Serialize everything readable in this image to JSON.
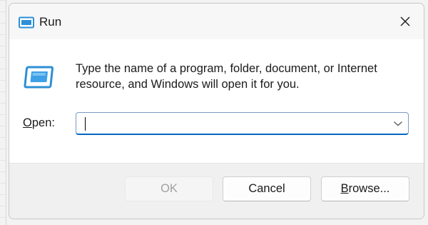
{
  "window": {
    "title": "Run",
    "close_glyph": "✕",
    "icons": {
      "title": "run-icon",
      "large": "run-icon",
      "close": "close-icon",
      "dropdown": "chevron-down-icon"
    }
  },
  "content": {
    "instructions": "Type the name of a program, folder, document, or Internet resource, and Windows will open it for you.",
    "open_label_mnemonic": "O",
    "open_label_rest": "pen:",
    "open_value": "",
    "open_placeholder": ""
  },
  "buttons": {
    "ok_label": "OK",
    "cancel_label": "Cancel",
    "browse_mnemonic": "B",
    "browse_rest": "rowse..."
  },
  "colors": {
    "accent": "#0067c0",
    "icon_blue": "#2d8fd6",
    "disabled_text": "#a0a0a0"
  }
}
